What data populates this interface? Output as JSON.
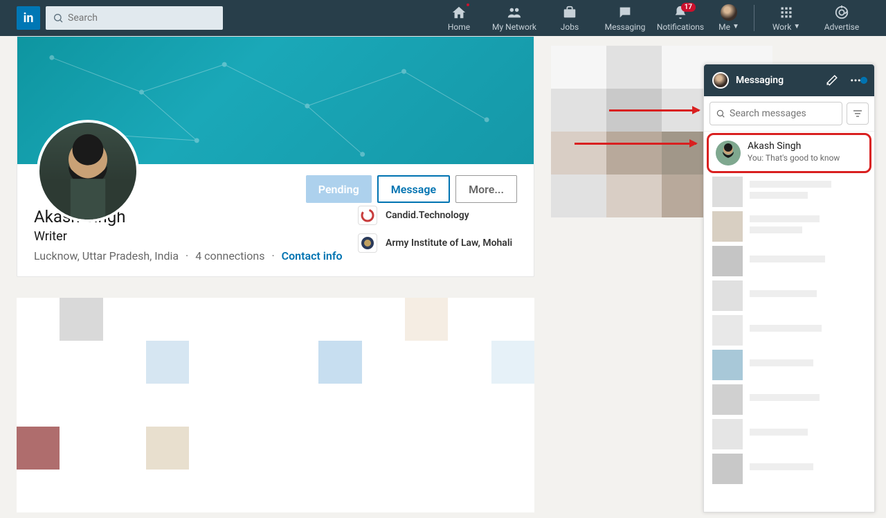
{
  "nav": {
    "search_placeholder": "Search",
    "items": {
      "home": "Home",
      "network": "My Network",
      "jobs": "Jobs",
      "messaging": "Messaging",
      "notifications": "Notifications",
      "notifications_badge": "17",
      "me": "Me",
      "work": "Work",
      "advertise": "Advertise"
    }
  },
  "profile": {
    "name": "Akash Singh",
    "title": "Writer",
    "location": "Lucknow, Uttar Pradesh, India",
    "connections": "4 connections",
    "contact": "Contact info",
    "actions": {
      "pending": "Pending",
      "message": "Message",
      "more": "More..."
    },
    "orgs": {
      "company": "Candid.Technology",
      "school": "Army Institute of Law, Mohali"
    }
  },
  "messaging_panel": {
    "title": "Messaging",
    "search_placeholder": "Search messages",
    "thread": {
      "name": "Akash Singh",
      "preview": "You: That's good to know"
    }
  }
}
